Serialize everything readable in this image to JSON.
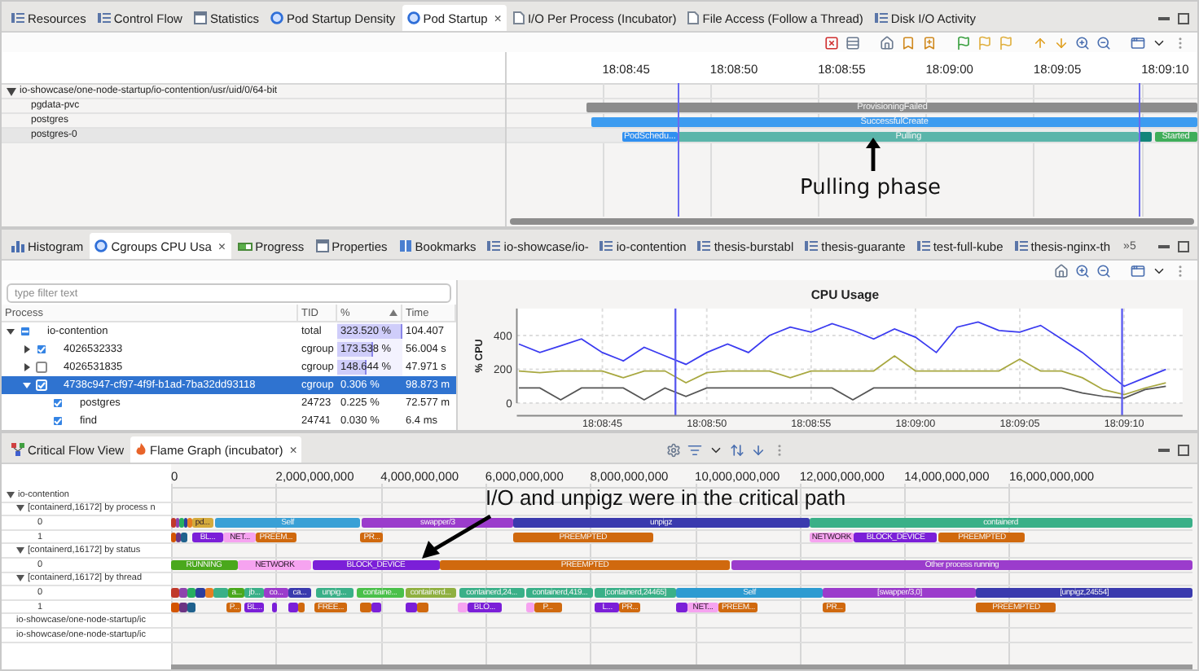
{
  "top_tabs": [
    {
      "label": "Resources",
      "selected": false
    },
    {
      "label": "Control Flow",
      "selected": false
    },
    {
      "label": "Statistics",
      "selected": false
    },
    {
      "label": "Pod Startup Density",
      "selected": false
    },
    {
      "label": "Pod Startup",
      "selected": true,
      "close": "×"
    },
    {
      "label": "I/O Per Process (Incubator)",
      "selected": false
    },
    {
      "label": "File Access (Follow a Thread)",
      "selected": false
    },
    {
      "label": "Disk I/O Activity",
      "selected": false
    }
  ],
  "pod_view": {
    "root": {
      "label": "io-showcase/one-node-startup/io-contention/usr/uid/0/64-bit",
      "expanded": true
    },
    "time_labels": [
      "18:08:45",
      "18:08:50",
      "18:08:55",
      "18:09:00",
      "18:09:05",
      "18:09:10"
    ],
    "annotation": "Pulling phase",
    "rows": [
      {
        "label": "pgdata-pvc",
        "selected": false,
        "bars": [
          {
            "label": "ProvisioningFailed",
            "color": "#8c8c8c"
          }
        ]
      },
      {
        "label": "postgres",
        "selected": false,
        "bars": [
          {
            "label": "SuccessfulCreate",
            "color": "#3d9cf0"
          }
        ]
      },
      {
        "label": "postgres-0",
        "selected": true,
        "bars": [
          {
            "label": "PodSchedu...",
            "color": "#2f8ff0"
          },
          {
            "label": "Pulling",
            "color": "#5bb5aa"
          },
          {
            "color": "#13857a"
          },
          {
            "label": "Started",
            "color": "#3fae5a"
          }
        ]
      }
    ]
  },
  "middle_tabs": [
    {
      "label": "Histogram",
      "selected": false
    },
    {
      "label": "Cgroups CPU Usa",
      "selected": true,
      "close": "×"
    },
    {
      "label": "Progress",
      "selected": false
    },
    {
      "label": "Properties",
      "selected": false
    },
    {
      "label": "Bookmarks",
      "selected": false
    },
    {
      "label": "io-showcase/io-",
      "selected": false
    },
    {
      "label": "io-contention",
      "selected": false
    },
    {
      "label": "thesis-burstabl",
      "selected": false
    },
    {
      "label": "thesis-guarante",
      "selected": false
    },
    {
      "label": "test-full-kube",
      "selected": false
    },
    {
      "label": "thesis-nginx-th",
      "selected": false
    }
  ],
  "middle_overflow": "»5",
  "cgroups": {
    "filter": {
      "placeholder": "type filter text"
    },
    "columns": [
      "Process",
      "TID",
      "%",
      "Time"
    ],
    "rows": [
      {
        "process": "io-contention",
        "tid": "total",
        "percent": "323.520 %",
        "level": 1,
        "time": "104.407",
        "mixed": true,
        "expanded": true,
        "selected": false,
        "children": [
          {
            "process": "4026532333",
            "tid": "cgroup",
            "percent": "173.538 %",
            "level": 0.54,
            "time": "56.004 s",
            "checked": true,
            "expanded": false,
            "selected": false
          },
          {
            "process": "4026531835",
            "tid": "cgroup",
            "percent": "148.644 %",
            "level": 0.46,
            "time": "47.971 s",
            "checked": false,
            "expanded": false,
            "selected": false
          },
          {
            "process": "4738c947-cf97-4f9f-b1ad-7ba32dd93118",
            "tid": "cgroup",
            "percent": "0.306 %",
            "time": "98.873 m",
            "checked": true,
            "expanded": true,
            "selected": true,
            "children": [
              {
                "process": "postgres",
                "tid": "24723",
                "percent": "0.225 %",
                "time": "72.577 m",
                "checked": true,
                "selected": false
              },
              {
                "process": "find",
                "tid": "24741",
                "percent": "0.030 %",
                "time": "6.4 ms",
                "checked": true,
                "selected": false
              }
            ]
          }
        ]
      }
    ]
  },
  "cpu_chart": {
    "chart_data": {
      "type": "line",
      "title": "CPU Usage",
      "ylabel": "% CPU",
      "categories": [
        null,
        null,
        null,
        null,
        "18:08:45",
        null,
        null,
        null,
        null,
        "18:08:50",
        null,
        null,
        null,
        null,
        "18:08:55",
        null,
        null,
        null,
        null,
        "18:09:00",
        null,
        null,
        null,
        null,
        "18:09:05",
        null,
        null,
        null,
        null,
        "18:09:10",
        null,
        null
      ],
      "series": [
        {
          "color": "#3b3bf0",
          "values": [
            350,
            300,
            340,
            380,
            300,
            250,
            330,
            280,
            230,
            300,
            350,
            300,
            400,
            450,
            420,
            470,
            430,
            380,
            440,
            390,
            300,
            450,
            480,
            430,
            420,
            460,
            380,
            300,
            200,
            100,
            150,
            200
          ]
        },
        {
          "color": "#a8a840",
          "values": [
            190,
            180,
            190,
            190,
            190,
            150,
            190,
            190,
            120,
            180,
            190,
            190,
            190,
            150,
            190,
            190,
            190,
            190,
            280,
            190,
            190,
            190,
            190,
            190,
            260,
            190,
            190,
            150,
            80,
            50,
            90,
            120
          ]
        },
        {
          "color": "#555555",
          "values": [
            90,
            90,
            20,
            90,
            90,
            90,
            20,
            90,
            40,
            90,
            90,
            90,
            90,
            90,
            90,
            90,
            20,
            90,
            90,
            90,
            90,
            90,
            90,
            90,
            90,
            90,
            90,
            60,
            40,
            30,
            80,
            100
          ]
        }
      ],
      "ylim": [
        0,
        560
      ],
      "yticks": [
        0,
        200,
        400
      ],
      "grid": true
    }
  },
  "bottom_tabs": [
    {
      "label": "Critical Flow View",
      "selected": false
    },
    {
      "label": "Flame Graph (incubator)",
      "selected": true,
      "close": "×"
    }
  ],
  "flame_graph": {
    "axis_labels": [
      "0",
      "2,000,000,000",
      "4,000,000,000",
      "6,000,000,000",
      "8,000,000,000",
      "10,000,000,000",
      "12,000,000,000",
      "14,000,000,000",
      "16,000,000,000"
    ],
    "annotation": "I/O and unpigz were in the critical path",
    "tree": [
      {
        "label": "io-contention",
        "expanded": true,
        "children": [
          {
            "label": "[containerd,16172] by process n",
            "expanded": true,
            "children": [
              {
                "label": "0",
                "segments": [
                  {
                    "color": "#c0392b"
                  },
                  {
                    "color": "#8e44ad"
                  },
                  {
                    "color": "#27ae60"
                  },
                  {
                    "color": "#2c3e9e"
                  },
                  {
                    "color": "#e67e22"
                  },
                  {
                    "label": "pd...",
                    "color": "#d4aa3c"
                  },
                  {
                    "label": "Self",
                    "color": "#39a0d6"
                  },
                  {
                    "label": "swapper/3",
                    "color": "#9b3ccc"
                  },
                  {
                    "label": "unpigz",
                    "color": "#3a3aae"
                  },
                  {
                    "label": "containerd",
                    "color": "#3ab088"
                  }
                ]
              },
              {
                "label": "1",
                "segments": [
                  {
                    "color": "#d35400"
                  },
                  {
                    "color": "#6c3483"
                  },
                  {
                    "color": "#1f618d"
                  },
                  {
                    "label": "BL...",
                    "color": "#7b1fd8"
                  },
                  {
                    "label": "NET...",
                    "color": "#f6a3f0"
                  },
                  {
                    "label": "PREEM...",
                    "color": "#d0690e"
                  },
                  {
                    "label": "PR...",
                    "color": "#d0690e"
                  },
                  {
                    "label": "PREEMPTED",
                    "color": "#d0690e"
                  },
                  {
                    "label": "NETWORK",
                    "color": "#f6a3f0"
                  },
                  {
                    "label": "BLOCK_DEVICE",
                    "color": "#7b1fd8"
                  },
                  {
                    "label": "PREEMPTED",
                    "color": "#d0690e"
                  }
                ]
              }
            ]
          },
          {
            "label": "[containerd,16172] by status",
            "expanded": true,
            "children": [
              {
                "label": "0",
                "segments": [
                  {
                    "label": "RUNNING",
                    "color": "#4aa81c"
                  },
                  {
                    "label": "NETWORK",
                    "color": "#f6a3f0"
                  },
                  {
                    "label": "BLOCK_DEVICE",
                    "color": "#7b1fd8"
                  },
                  {
                    "label": "PREEMPTED",
                    "color": "#d0690e"
                  },
                  {
                    "label": "Other process running",
                    "color": "#9b3ccc"
                  }
                ]
              }
            ]
          },
          {
            "label": "[containerd,16172] by thread",
            "expanded": true,
            "children": [
              {
                "label": "0",
                "segments": [
                  {
                    "color": "#c0392b"
                  },
                  {
                    "color": "#8e44ad"
                  },
                  {
                    "color": "#27ae60"
                  },
                  {
                    "color": "#2c3e9e"
                  },
                  {
                    "color": "#e67e22"
                  },
                  {
                    "color": "#3ab088"
                  },
                  {
                    "label": "a...",
                    "color": "#4aa81c"
                  },
                  {
                    "label": "jb...",
                    "color": "#3ab088"
                  },
                  {
                    "label": "co...",
                    "color": "#9b3ccc"
                  },
                  {
                    "label": "ca...",
                    "color": "#3a3aae"
                  },
                  {
                    "label": "unpig...",
                    "color": "#3ab088"
                  },
                  {
                    "label": "containe...",
                    "color": "#4ac04a"
                  },
                  {
                    "label": "containerd...",
                    "color": "#8fb040"
                  },
                  {
                    "label": "containerd,24...",
                    "color": "#3ab088"
                  },
                  {
                    "label": "containerd,419...",
                    "color": "#3ab088"
                  },
                  {
                    "label": "[containerd,24465]",
                    "color": "#3ab088"
                  },
                  {
                    "label": "Self",
                    "color": "#2d9bd1"
                  },
                  {
                    "label": "[swapper/3,0]",
                    "color": "#9b3ccc"
                  },
                  {
                    "label": "[unpigz,24554]",
                    "color": "#3a3aae"
                  }
                ]
              },
              {
                "label": "1",
                "segments": [
                  {
                    "color": "#d35400"
                  },
                  {
                    "color": "#6c3483"
                  },
                  {
                    "color": "#1f618d"
                  },
                  {
                    "label": "P...",
                    "color": "#d0690e"
                  },
                  {
                    "label": "BL...",
                    "color": "#7b1fd8"
                  },
                  {
                    "color": "#7b1fd8"
                  },
                  {
                    "color": "#7b1fd8"
                  },
                  {
                    "color": "#d0690e"
                  },
                  {
                    "label": "FREE...",
                    "color": "#d0690e"
                  },
                  {
                    "color": "#d0690e"
                  },
                  {
                    "color": "#7b1fd8"
                  },
                  {
                    "color": "#7b1fd8"
                  },
                  {
                    "color": "#d0690e"
                  },
                  {
                    "color": "#f6a3f0"
                  },
                  {
                    "label": "BLO...",
                    "color": "#7b1fd8"
                  },
                  {
                    "color": "#f6a3f0"
                  },
                  {
                    "label": "P...",
                    "color": "#d0690e"
                  },
                  {
                    "label": "L...",
                    "color": "#7b1fd8"
                  },
                  {
                    "label": "PR...",
                    "color": "#d0690e"
                  },
                  {
                    "color": "#7b1fd8"
                  },
                  {
                    "label": "NET...",
                    "color": "#f6a3f0"
                  },
                  {
                    "label": "PREEM...",
                    "color": "#d0690e"
                  },
                  {
                    "label": "PR...",
                    "color": "#d0690e"
                  },
                  {
                    "label": "PREEMPTED",
                    "color": "#d0690e"
                  }
                ]
              }
            ]
          },
          {
            "label": "io-showcase/one-node-startup/ic"
          },
          {
            "label": "io-showcase/one-node-startup/ic"
          }
        ]
      }
    ]
  }
}
